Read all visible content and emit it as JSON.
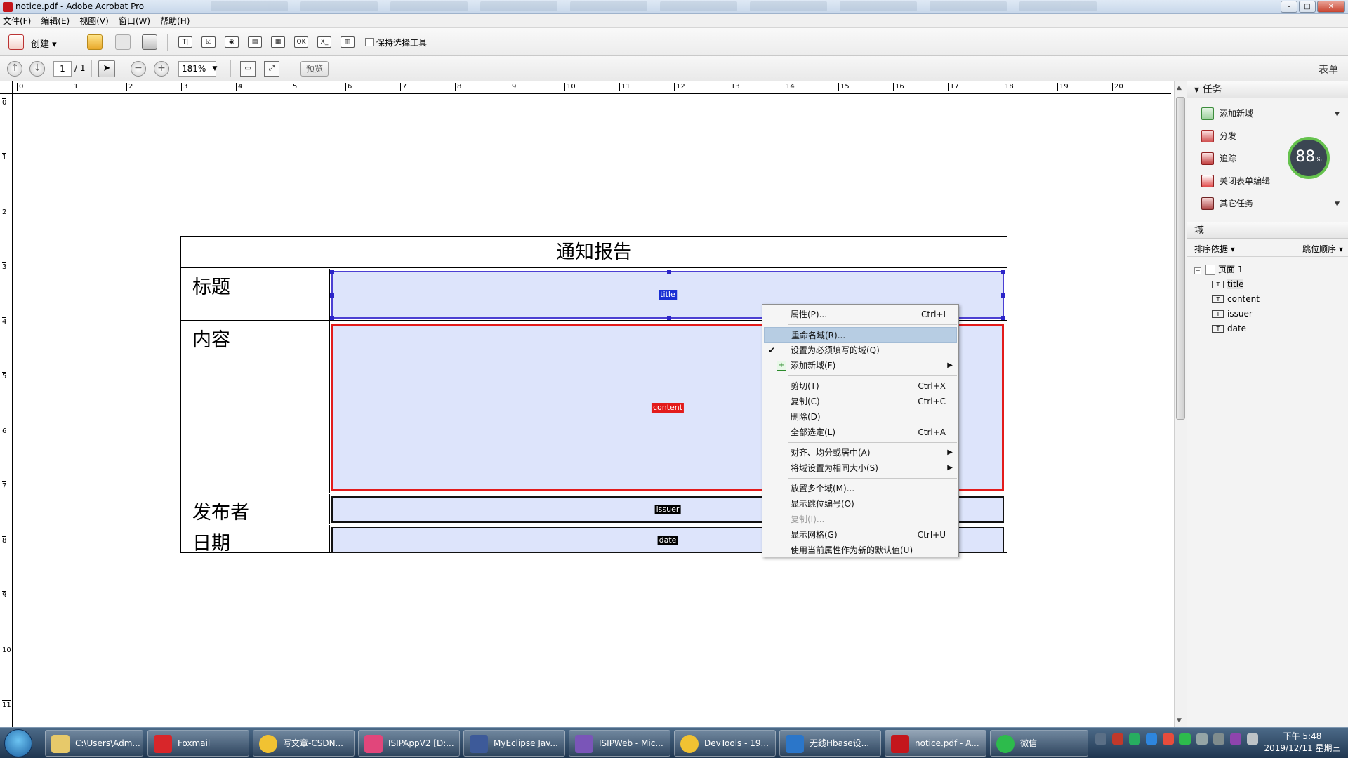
{
  "window": {
    "title": "notice.pdf - Adobe Acrobat Pro",
    "minimize": "–",
    "maximize": "□",
    "close": "✕"
  },
  "menu": [
    "文件(F)",
    "编辑(E)",
    "视图(V)",
    "窗口(W)",
    "帮助(H)"
  ],
  "toolbar1": {
    "create_label": "创建 ▾",
    "keep_tool_label": "保持选择工具",
    "tools": [
      "T|",
      "☑",
      "◉",
      "▤",
      "▦",
      "OK",
      "X_",
      "▥"
    ]
  },
  "toolbar2": {
    "page_current": "1",
    "page_total": "/ 1",
    "zoom": "181%",
    "preview_label": "预览",
    "mode_label": "表单"
  },
  "ruler": {
    "top": [
      "0",
      "1",
      "2",
      "3",
      "4",
      "5",
      "6",
      "7",
      "8",
      "9",
      "10",
      "11",
      "12",
      "13",
      "14",
      "15",
      "16",
      "17",
      "18",
      "19",
      "20"
    ],
    "left": [
      "0",
      "1",
      "2",
      "3",
      "4",
      "5",
      "6",
      "7",
      "8",
      "9",
      "10",
      "11"
    ]
  },
  "form": {
    "title": "通知报告",
    "rows": [
      {
        "label": "标题",
        "field": "title"
      },
      {
        "label": "内容",
        "field": "content"
      },
      {
        "label": "发布者",
        "field": "issuer"
      },
      {
        "label": "日期",
        "field": "date"
      }
    ]
  },
  "context_menu": [
    {
      "label": "属性(P)...",
      "shortcut": "Ctrl+I"
    },
    {
      "sep": true
    },
    {
      "label": "重命名域(R)...",
      "hover": true
    },
    {
      "label": "设置为必须填写的域(Q)",
      "check": "✔"
    },
    {
      "label": "添加新域(F)",
      "arrow": "▶",
      "icon": "+"
    },
    {
      "sep": true
    },
    {
      "label": "剪切(T)",
      "shortcut": "Ctrl+X"
    },
    {
      "label": "复制(C)",
      "shortcut": "Ctrl+C"
    },
    {
      "label": "删除(D)"
    },
    {
      "label": "全部选定(L)",
      "shortcut": "Ctrl+A"
    },
    {
      "sep": true
    },
    {
      "label": "对齐、均分或居中(A)",
      "arrow": "▶"
    },
    {
      "label": "将域设置为相同大小(S)",
      "arrow": "▶"
    },
    {
      "sep": true
    },
    {
      "label": "放置多个域(M)..."
    },
    {
      "label": "显示跳位编号(O)"
    },
    {
      "label": "复制(I)...",
      "disabled": true
    },
    {
      "label": "显示网格(G)",
      "shortcut": "Ctrl+U"
    },
    {
      "label": "使用当前属性作为新的默认值(U)"
    }
  ],
  "right_panel": {
    "tasks_header": "任务",
    "tasks": [
      "添加新域",
      "分发",
      "追踪",
      "关闭表单编辑",
      "其它任务"
    ],
    "fields_header": "域",
    "sort_label": "排序依据 ▾",
    "tab_order_label": "跳位顺序 ▾",
    "tree_root": "页面 1",
    "tree_items": [
      "title",
      "content",
      "issuer",
      "date"
    ],
    "gauge_value": "88",
    "gauge_unit": "%"
  },
  "taskbar": {
    "items": [
      "C:\\Users\\Adm...",
      "Foxmail",
      "写文章-CSDN...",
      "ISIPAppV2 [D:...",
      "MyEclipse Jav...",
      "ISIPWeb - Mic...",
      "DevTools - 19...",
      "无线Hbase设...",
      "notice.pdf - A...",
      "微信"
    ],
    "clock_time": "下午 5:48",
    "clock_date": "2019/12/11 星期三"
  }
}
